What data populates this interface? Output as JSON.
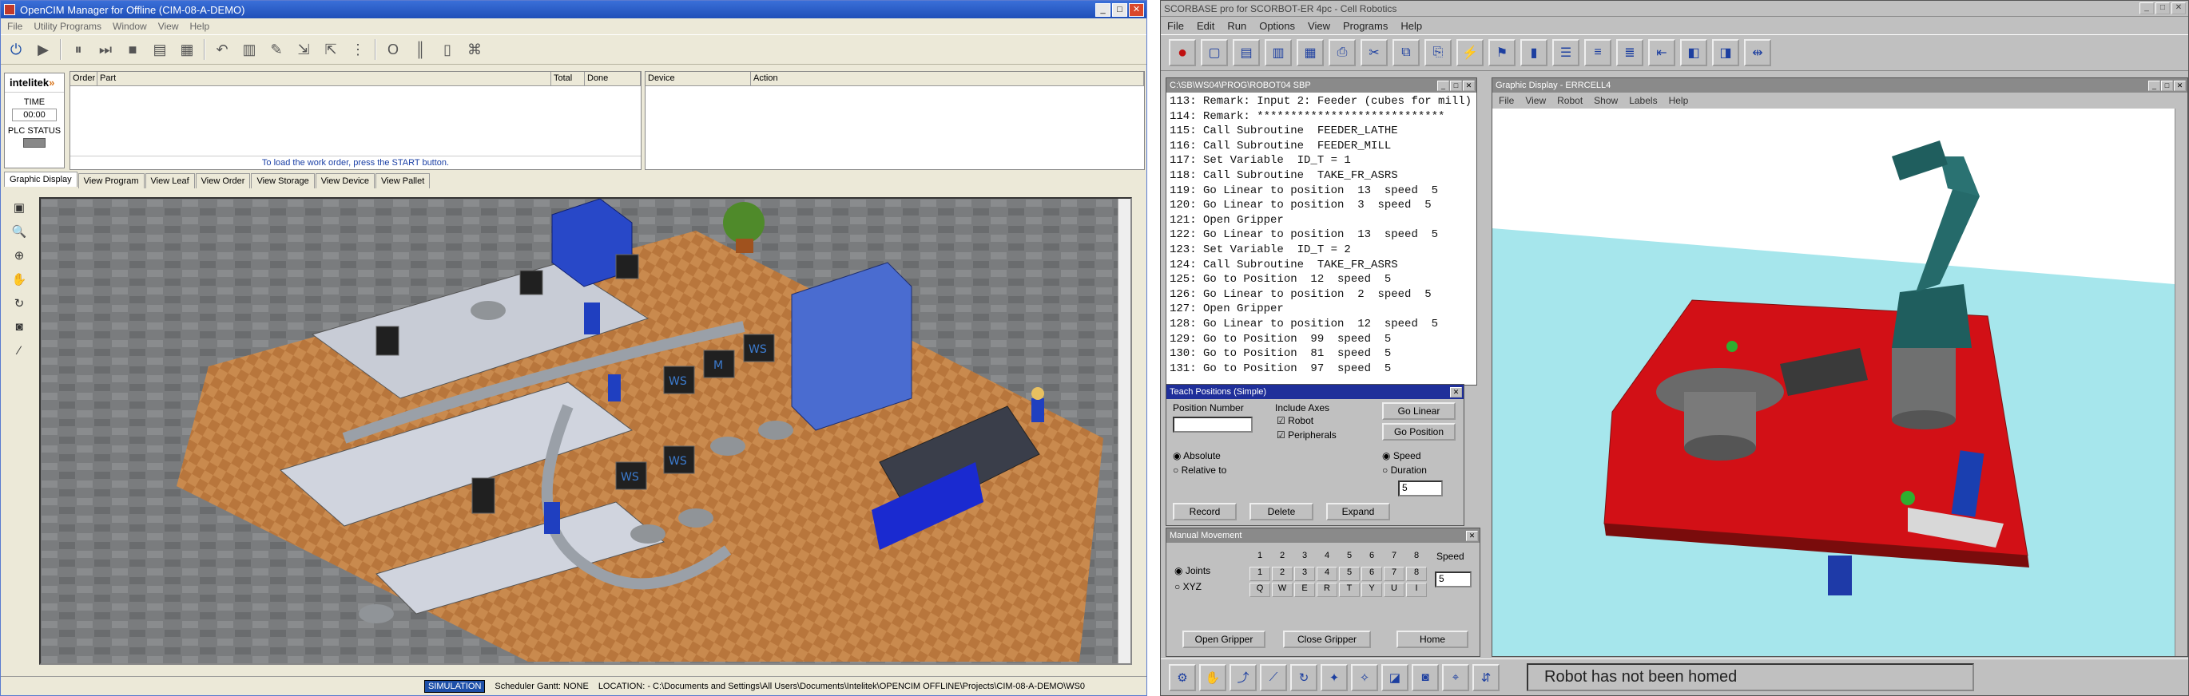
{
  "left_window": {
    "title": "OpenCIM Manager for Offline (CIM-08-A-DEMO)",
    "menu": [
      "File",
      "Utility Programs",
      "Window",
      "View",
      "Help"
    ],
    "logo": {
      "name": "intelitek",
      "mark": "»"
    },
    "time_label": "TIME",
    "time_value": "00:00",
    "plc_status_label": "PLC STATUS",
    "order_columns": [
      "Order",
      "Part",
      "Total",
      "Done"
    ],
    "device_columns": [
      "Device",
      "Action"
    ],
    "order_message": "To load the work order, press the START button.",
    "tabs": [
      "Graphic Display",
      "View Program",
      "View Leaf",
      "View Order",
      "View Storage",
      "View Device",
      "View Pallet"
    ],
    "status": {
      "simulation": "SIMULATION",
      "scheduler": "Scheduler Gantt: NONE",
      "location": "LOCATION:   - C:\\Documents and Settings\\All Users\\Documents\\Intelitek\\OPENCIM OFFLINE\\Projects\\CIM-08-A-DEMO\\WS0"
    },
    "monitor_labels": [
      "WS",
      "M",
      "WS",
      "WS",
      "WS"
    ]
  },
  "right_window": {
    "title": "SCORBASE pro  for  SCORBOT-ER 4pc  -  Cell Robotics",
    "menu": [
      "File",
      "Edit",
      "Run",
      "Options",
      "View",
      "Programs",
      "Help"
    ],
    "program_window_title": "C:\\SB\\WS04\\PROG\\ROBOT04 SBP",
    "program_lines": [
      "113: Remark: Input 2: Feeder (cubes for mill)",
      "114: Remark: ****************************",
      "115: Call Subroutine  FEEDER_LATHE",
      "116: Call Subroutine  FEEDER_MILL",
      "117: Set Variable  ID_T = 1",
      "118: Call Subroutine  TAKE_FR_ASRS",
      "119: Go Linear to position  13  speed  5",
      "120: Go Linear to position  3  speed  5",
      "121: Open Gripper",
      "122: Go Linear to position  13  speed  5",
      "123: Set Variable  ID_T = 2",
      "124: Call Subroutine  TAKE_FR_ASRS",
      "125: Go to Position  12  speed  5",
      "126: Go Linear to position  2  speed  5",
      "127: Open Gripper",
      "128: Go Linear to position  12  speed  5",
      "129: Go to Position  99  speed  5",
      "130: Go to Position  81  speed  5",
      "131: Go to Position  97  speed  5"
    ],
    "teach": {
      "title": "Teach Positions  (Simple)",
      "position_number_label": "Position Number",
      "include_axes_label": "Include Axes",
      "robot_label": "Robot",
      "peripherals_label": "Peripherals",
      "go_linear": "Go Linear",
      "go_position": "Go Position",
      "absolute_label": "Absolute",
      "relative_label": "Relative to",
      "speed_label": "Speed",
      "duration_label": "Duration",
      "speed_value": "5",
      "record": "Record",
      "delete": "Delete",
      "expand": "Expand"
    },
    "manual": {
      "title": "Manual Movement",
      "joints_label": "Joints",
      "xyz_label": "XYZ",
      "axis_numbers": [
        "1",
        "2",
        "3",
        "4",
        "5",
        "6",
        "7",
        "8"
      ],
      "plus_row": [
        "1",
        "2",
        "3",
        "4",
        "5",
        "6",
        "7",
        "8"
      ],
      "minus_row": [
        "Q",
        "W",
        "E",
        "R",
        "T",
        "Y",
        "U",
        "I"
      ],
      "speed_label": "Speed",
      "speed_value": "5",
      "open_gripper": "Open Gripper",
      "close_gripper": "Close Gripper",
      "home": "Home"
    },
    "graphic": {
      "title": "Graphic Display - ERRCELL4",
      "menu": [
        "File",
        "View",
        "Robot",
        "Show",
        "Labels",
        "Help"
      ]
    },
    "status_message": "Robot has not been homed"
  }
}
